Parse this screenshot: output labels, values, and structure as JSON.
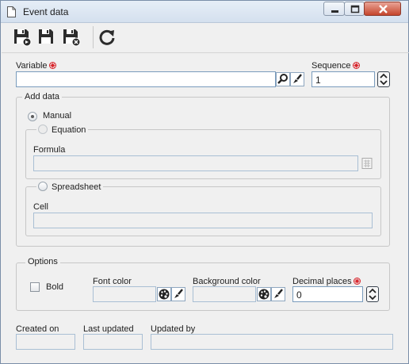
{
  "window": {
    "title": "Event data"
  },
  "icons": {
    "doc": "document-icon",
    "minimize": "minimize-icon",
    "maximize": "maximize-icon",
    "close": "close-icon",
    "save_new": "save-and-new-icon",
    "save": "save-icon",
    "save_close": "save-and-close-icon",
    "refresh": "refresh-icon",
    "search": "magnifier-icon",
    "clear": "brush-icon",
    "palette": "palette-icon",
    "calculator": "calculator-icon"
  },
  "colors": {
    "required": "#d8232a",
    "input_border": "#7a9cbd",
    "title_bg": "#dce6f2"
  },
  "form": {
    "variable": {
      "label": "Variable",
      "value": ""
    },
    "sequence": {
      "label": "Sequence",
      "value": "1"
    },
    "add_data": {
      "legend": "Add data",
      "manual_label": "Manual",
      "manual_selected": true,
      "equation_label": "Equation",
      "formula_label": "Formula",
      "formula_value": "",
      "spreadsheet_label": "Spreadsheet",
      "cell_label": "Cell",
      "cell_value": ""
    },
    "options": {
      "legend": "Options",
      "bold_label": "Bold",
      "bold_checked": false,
      "font_color_label": "Font color",
      "background_color_label": "Background color",
      "decimal_places_label": "Decimal places",
      "decimal_places_value": "0"
    },
    "meta": {
      "created_on_label": "Created on",
      "created_on_value": "",
      "last_updated_label": "Last updated",
      "last_updated_value": "",
      "updated_by_label": "Updated by",
      "updated_by_value": ""
    }
  }
}
